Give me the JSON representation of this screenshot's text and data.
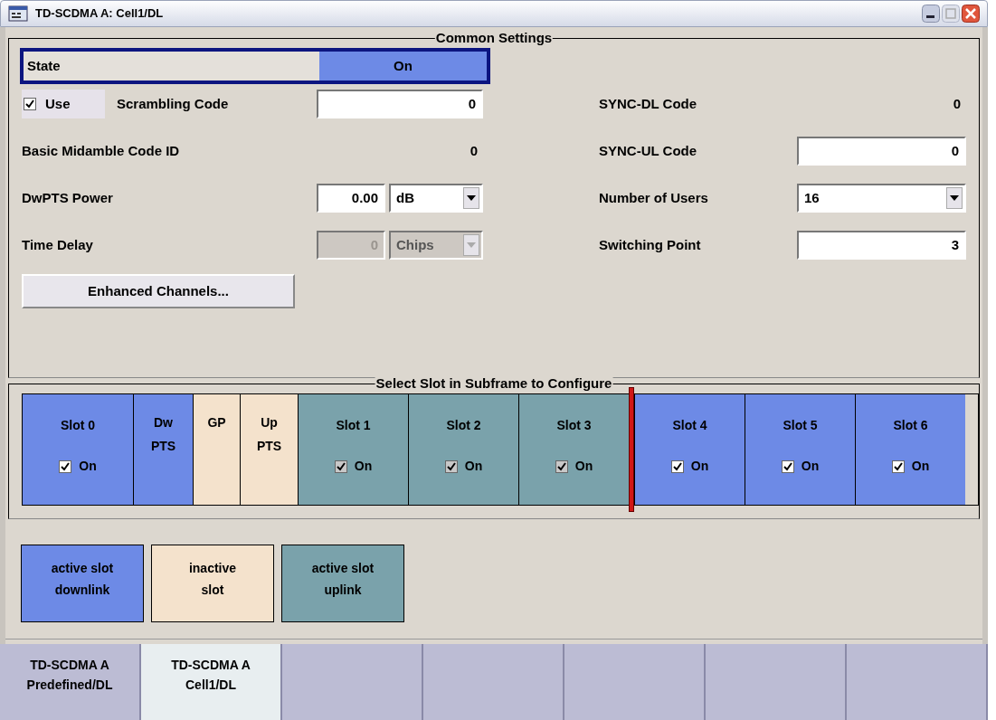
{
  "window": {
    "title": "TD-SCDMA A: Cell1/DL"
  },
  "common_settings": {
    "title": "Common Settings",
    "state": {
      "label": "State",
      "value": "On",
      "on": true
    },
    "left_rows": [
      {
        "kind": "field",
        "checkbox": {
          "label": "Use",
          "checked": true
        },
        "label": "Scrambling Code",
        "value": "0"
      },
      {
        "kind": "readout",
        "label": "Basic Midamble Code ID",
        "value": "0"
      },
      {
        "kind": "unit",
        "label": "DwPTS Power",
        "value": "0.00",
        "unit": "dB",
        "disabled": false
      },
      {
        "kind": "unit",
        "label": "Time Delay",
        "value": "0",
        "unit": "Chips",
        "disabled": true
      }
    ],
    "right_rows": [
      {
        "kind": "readout",
        "label": "SYNC-DL Code",
        "value": "0"
      },
      {
        "kind": "field",
        "label": "SYNC-UL Code",
        "value": "0"
      },
      {
        "kind": "dropdown",
        "label": "Number of Users",
        "value": "16"
      },
      {
        "kind": "field",
        "label": "Switching Point",
        "value": "3"
      }
    ],
    "button": "Enhanced Channels..."
  },
  "slot_section": {
    "title": "Select Slot in Subframe to Configure",
    "slots": [
      {
        "kind": "downlink",
        "label": "Slot 0",
        "checkbox": {
          "label": "On",
          "checked": true,
          "disabled": false
        },
        "switch_after": false
      },
      {
        "kind": "downlink",
        "label": "Dw\nPTS",
        "switch_after": false
      },
      {
        "kind": "inactive",
        "label": "GP",
        "switch_after": false
      },
      {
        "kind": "inactive",
        "label": "Up\nPTS",
        "switch_after": false
      },
      {
        "kind": "uplink",
        "label": "Slot 1",
        "checkbox": {
          "label": "On",
          "checked": true,
          "disabled": true
        },
        "switch_after": false
      },
      {
        "kind": "uplink",
        "label": "Slot 2",
        "checkbox": {
          "label": "On",
          "checked": true,
          "disabled": true
        },
        "switch_after": false
      },
      {
        "kind": "uplink",
        "label": "Slot 3",
        "checkbox": {
          "label": "On",
          "checked": true,
          "disabled": true
        },
        "switch_after": true
      },
      {
        "kind": "downlink",
        "label": "Slot 4",
        "checkbox": {
          "label": "On",
          "checked": true,
          "disabled": false
        },
        "switch_after": false
      },
      {
        "kind": "downlink",
        "label": "Slot 5",
        "checkbox": {
          "label": "On",
          "checked": true,
          "disabled": false
        },
        "switch_after": false
      },
      {
        "kind": "downlink",
        "label": "Slot 6",
        "checkbox": {
          "label": "On",
          "checked": true,
          "disabled": false
        },
        "switch_after": false
      }
    ]
  },
  "legend": [
    {
      "kind": "downlink",
      "label": "active slot\ndownlink"
    },
    {
      "kind": "inactive",
      "label": "inactive\nslot"
    },
    {
      "kind": "uplink",
      "label": "active slot\nuplink"
    }
  ],
  "tabs": [
    {
      "label": "TD-SCDMA A\nPredefined/DL",
      "selected": false
    },
    {
      "label": "TD-SCDMA A\nCell1/DL",
      "selected": true
    },
    {
      "selected": false
    },
    {
      "selected": false
    },
    {
      "selected": false
    },
    {
      "selected": false
    },
    {
      "selected": false
    }
  ]
}
